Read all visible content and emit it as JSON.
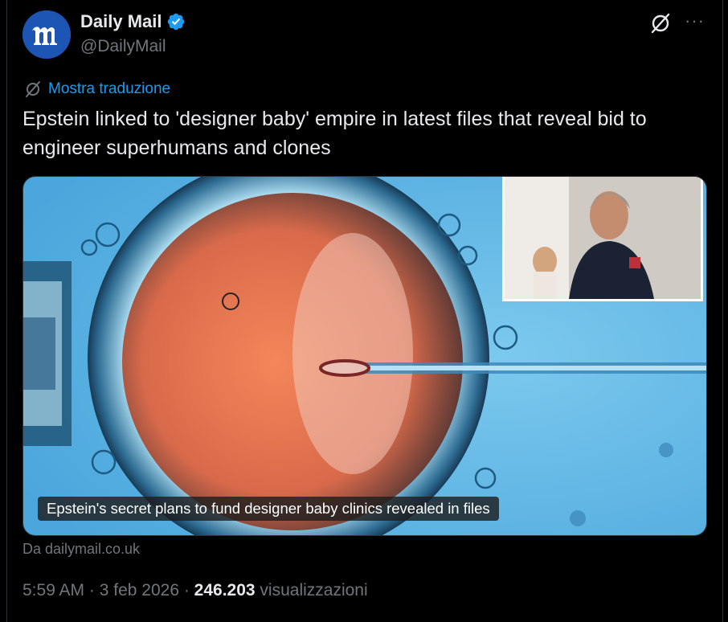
{
  "author": {
    "display_name": "Daily Mail",
    "handle": "@DailyMail",
    "avatar_letter": "m",
    "avatar_color": "#1d55b5",
    "verified": true,
    "verified_color": "#1d9bf0"
  },
  "header_icons": [
    "grok-icon",
    "more-icon"
  ],
  "more_glyph": "···",
  "translate": {
    "icon": "translate-icon",
    "label": "Mostra traduzione"
  },
  "tweet": {
    "text": "Epstein linked to 'designer baby' empire in latest files that reveal bid to engineer superhumans and clones"
  },
  "media": {
    "caption": "Epstein's secret plans to fund designer baby clinics revealed in files",
    "source": "Da dailymail.co.uk"
  },
  "meta": {
    "time": "5:59 AM",
    "sep1": " · ",
    "date": "3 feb 2026",
    "sep2": " · ",
    "views_count": "246.203",
    "views_label": " visualizzazioni"
  },
  "colors": {
    "background": "#000000",
    "text_primary": "#e7e9ea",
    "text_secondary": "#71767b",
    "link": "#1d9bf0",
    "border": "#2f3336"
  }
}
